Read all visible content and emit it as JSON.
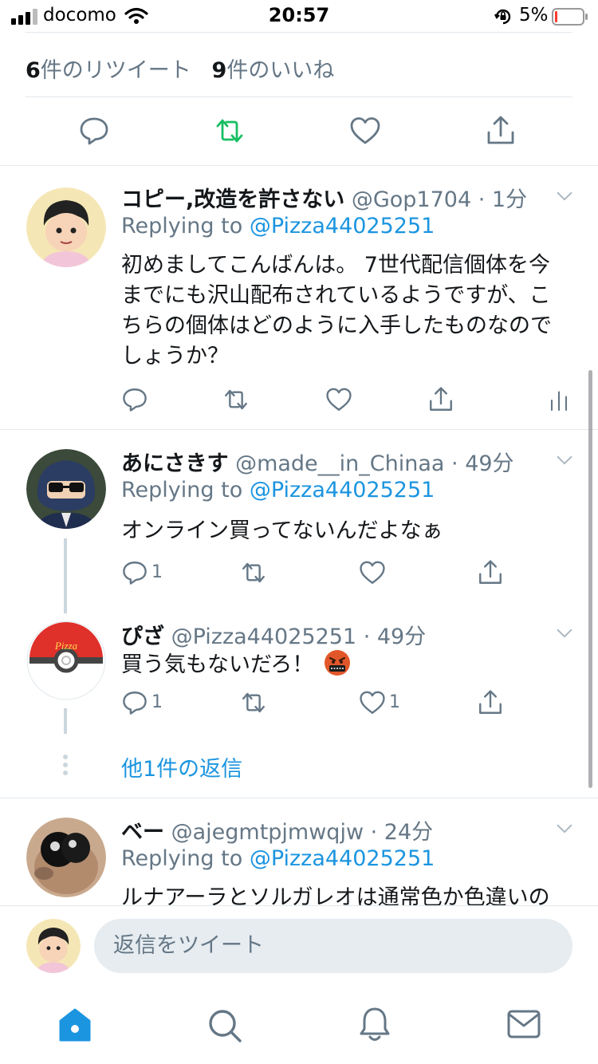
{
  "status_bar": {
    "carrier": "docomo",
    "time": "20:57",
    "battery_percent": "5%"
  },
  "stats": {
    "retweets_count": "6",
    "retweets_label": "件のリツイート",
    "likes_count": "9",
    "likes_label": "件のいいね"
  },
  "tweets": [
    {
      "name": "コピー,改造を許さない",
      "handle": "@Gop1704",
      "time": "1分",
      "replying_prefix": "Replying to ",
      "replying_to": "@Pizza44025251",
      "text_lines": [
        "初めましてこんばんは。 7世代配信個体を今",
        "までにも沢山配布されているようですが、こ",
        "ちらの個体はどのように入手したものなので",
        "しょうか？"
      ]
    },
    {
      "name": "あにさきす",
      "handle": "@made__in_Chinaa",
      "time": "49分",
      "replying_prefix": "Replying to ",
      "replying_to": "@Pizza44025251",
      "text": "オンライン買ってないんだよなぁ",
      "reply_count": "1"
    },
    {
      "name": "ぴざ",
      "handle": "@Pizza44025251",
      "time": "49分",
      "text": "買う気もないだろ！",
      "reply_count": "1",
      "like_count": "1",
      "avatar_text": "Pizza"
    },
    {
      "name": "ベー",
      "handle": "@ajegmtpjmwqjw",
      "time": "24分",
      "replying_prefix": "Replying to ",
      "replying_to": "@Pizza44025251",
      "text": "ルナアーラとソルガレオは通常色か色違いの"
    }
  ],
  "more_replies": "他1件の返信",
  "composer": {
    "placeholder": "返信をツイート"
  },
  "icons": {
    "reply": "speech-bubble-icon",
    "retweet": "retweet-icon",
    "like": "heart-icon",
    "share": "share-icon",
    "analytics": "analytics-icon",
    "chevron": "chevron-down-icon",
    "home": "home-icon",
    "search": "search-icon",
    "notifications": "bell-icon",
    "messages": "envelope-icon"
  },
  "colors": {
    "accent": "#1b95e0",
    "retweet_active": "#17bf63",
    "muted": "#657786",
    "divider": "#e1e8ed"
  }
}
